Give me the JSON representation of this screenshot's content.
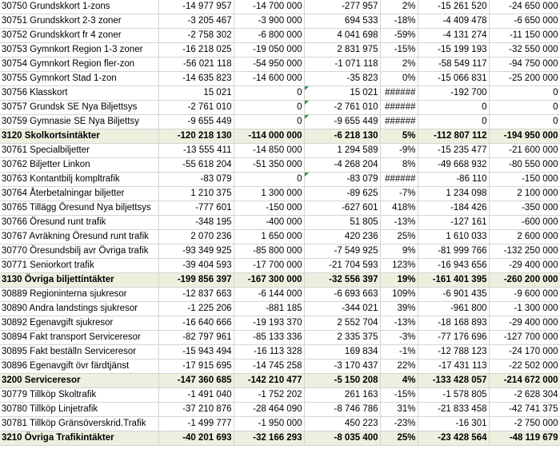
{
  "sheet": {
    "rows": [
      {
        "name": "30750 Grundskkort 1-zons",
        "c1": "-14 977 957",
        "c2": "-14 700 000",
        "c3": "-277 957",
        "c4": "2%",
        "c5": "-15 261 520",
        "c6": "-24 650 000",
        "sum": false,
        "flag": false
      },
      {
        "name": "30751 Grundskkort 2-3 zoner",
        "c1": "-3 205 467",
        "c2": "-3 900 000",
        "c3": "694 533",
        "c4": "-18%",
        "c5": "-4 409 478",
        "c6": "-6 650 000",
        "sum": false,
        "flag": false
      },
      {
        "name": "30752 Grundskkort fr 4 zoner",
        "c1": "-2 758 302",
        "c2": "-6 800 000",
        "c3": "4 041 698",
        "c4": "-59%",
        "c5": "-4 131 274",
        "c6": "-11 150 000",
        "sum": false,
        "flag": false
      },
      {
        "name": "30753 Gymnkort Region 1-3 zoner",
        "c1": "-16 218 025",
        "c2": "-19 050 000",
        "c3": "2 831 975",
        "c4": "-15%",
        "c5": "-15 199 193",
        "c6": "-32 550 000",
        "sum": false,
        "flag": false
      },
      {
        "name": "30754 Gymnkort Region fler-zon",
        "c1": "-56 021 118",
        "c2": "-54 950 000",
        "c3": "-1 071 118",
        "c4": "2%",
        "c5": "-58 549 117",
        "c6": "-94 750 000",
        "sum": false,
        "flag": false
      },
      {
        "name": "30755 Gymnkort Stad 1-zon",
        "c1": "-14 635 823",
        "c2": "-14 600 000",
        "c3": "-35 823",
        "c4": "0%",
        "c5": "-15 066 831",
        "c6": "-25 200 000",
        "sum": false,
        "flag": false
      },
      {
        "name": "30756 Klasskort",
        "c1": "15 021",
        "c2": "0",
        "c3": "15 021",
        "c4": "######",
        "c5": "-192 700",
        "c6": "0",
        "sum": false,
        "flag": true
      },
      {
        "name": "30757 Grundsk SE Nya Biljettsys",
        "c1": "-2 761 010",
        "c2": "0",
        "c3": "-2 761 010",
        "c4": "######",
        "c5": "0",
        "c6": "0",
        "sum": false,
        "flag": true
      },
      {
        "name": "30759 Gymnasie SE Nya Biljettsy",
        "c1": "-9 655 449",
        "c2": "0",
        "c3": "-9 655 449",
        "c4": "######",
        "c5": "0",
        "c6": "0",
        "sum": false,
        "flag": true
      },
      {
        "name": "3120 Skolkortsintäkter",
        "c1": "-120 218 130",
        "c2": "-114 000 000",
        "c3": "-6 218 130",
        "c4": "5%",
        "c5": "-112 807 112",
        "c6": "-194 950 000",
        "sum": true,
        "flag": false
      },
      {
        "name": "30761 Specialbiljetter",
        "c1": "-13 555 411",
        "c2": "-14 850 000",
        "c3": "1 294 589",
        "c4": "-9%",
        "c5": "-15 235 477",
        "c6": "-21 600 000",
        "sum": false,
        "flag": false
      },
      {
        "name": "30762 Biljetter Linkon",
        "c1": "-55 618 204",
        "c2": "-51 350 000",
        "c3": "-4 268 204",
        "c4": "8%",
        "c5": "-49 668 932",
        "c6": "-80 550 000",
        "sum": false,
        "flag": false
      },
      {
        "name": "30763 Kontantbilj kompltrafik",
        "c1": "-83 079",
        "c2": "0",
        "c3": "-83 079",
        "c4": "######",
        "c5": "-86 110",
        "c6": "-150 000",
        "sum": false,
        "flag": true
      },
      {
        "name": "30764 Återbetalningar biljetter",
        "c1": "1 210 375",
        "c2": "1 300 000",
        "c3": "-89 625",
        "c4": "-7%",
        "c5": "1 234 098",
        "c6": "2 100 000",
        "sum": false,
        "flag": false
      },
      {
        "name": "30765 Tillägg Öresund Nya biljettsys",
        "c1": "-777 601",
        "c2": "-150 000",
        "c3": "-627 601",
        "c4": "418%",
        "c5": "-184 426",
        "c6": "-350 000",
        "sum": false,
        "flag": false
      },
      {
        "name": "30766 Öresund runt trafik",
        "c1": "-348 195",
        "c2": "-400 000",
        "c3": "51 805",
        "c4": "-13%",
        "c5": "-127 161",
        "c6": "-600 000",
        "sum": false,
        "flag": false
      },
      {
        "name": "30767 Avräkning Öresund runt trafik",
        "c1": "2 070 236",
        "c2": "1 650 000",
        "c3": "420 236",
        "c4": "25%",
        "c5": "1 610 033",
        "c6": "2 600 000",
        "sum": false,
        "flag": false
      },
      {
        "name": "30770 Öresundsbilj avr Övriga trafik",
        "c1": "-93 349 925",
        "c2": "-85 800 000",
        "c3": "-7 549 925",
        "c4": "9%",
        "c5": "-81 999 766",
        "c6": "-132 250 000",
        "sum": false,
        "flag": false
      },
      {
        "name": "30771 Seniorkort trafik",
        "c1": "-39 404 593",
        "c2": "-17 700 000",
        "c3": "-21 704 593",
        "c4": "123%",
        "c5": "-16 943 656",
        "c6": "-29 400 000",
        "sum": false,
        "flag": false
      },
      {
        "name": "3130 Övriga biljettintäkter",
        "c1": "-199 856 397",
        "c2": "-167 300 000",
        "c3": "-32 556 397",
        "c4": "19%",
        "c5": "-161 401 395",
        "c6": "-260 200 000",
        "sum": true,
        "flag": false
      },
      {
        "name": "30889 Regioninterna sjukresor",
        "c1": "-12 837 663",
        "c2": "-6 144 000",
        "c3": "-6 693 663",
        "c4": "109%",
        "c5": "-6 901 435",
        "c6": "-9 600 000",
        "sum": false,
        "flag": false
      },
      {
        "name": "30890 Andra landstings sjukresor",
        "c1": "-1 225 206",
        "c2": "-881 185",
        "c3": "-344 021",
        "c4": "39%",
        "c5": "-961 800",
        "c6": "-1 300 000",
        "sum": false,
        "flag": false
      },
      {
        "name": "30892 Egenavgift sjukresor",
        "c1": "-16 640 666",
        "c2": "-19 193 370",
        "c3": "2 552 704",
        "c4": "-13%",
        "c5": "-18 168 893",
        "c6": "-29 400 000",
        "sum": false,
        "flag": false
      },
      {
        "name": "30894 Fakt transport Serviceresor",
        "c1": "-82 797 961",
        "c2": "-85 133 336",
        "c3": "2 335 375",
        "c4": "-3%",
        "c5": "-77 176 696",
        "c6": "-127 700 000",
        "sum": false,
        "flag": false
      },
      {
        "name": "30895 Fakt beställn Serviceresor",
        "c1": "-15 943 494",
        "c2": "-16 113 328",
        "c3": "169 834",
        "c4": "-1%",
        "c5": "-12 788 123",
        "c6": "-24 170 000",
        "sum": false,
        "flag": false
      },
      {
        "name": "30896 Egenavgift övr färdtjänst",
        "c1": "-17 915 695",
        "c2": "-14 745 258",
        "c3": "-3 170 437",
        "c4": "22%",
        "c5": "-17 431 113",
        "c6": "-22 502 000",
        "sum": false,
        "flag": false
      },
      {
        "name": "3200 Serviceresor",
        "c1": "-147 360 685",
        "c2": "-142 210 477",
        "c3": "-5 150 208",
        "c4": "4%",
        "c5": "-133 428 057",
        "c6": "-214 672 000",
        "sum": true,
        "flag": false
      },
      {
        "name": "30779 Tillköp Skoltrafik",
        "c1": "-1 491 040",
        "c2": "-1 752 202",
        "c3": "261 163",
        "c4": "-15%",
        "c5": "-1 578 805",
        "c6": "-2 628 304",
        "sum": false,
        "flag": false
      },
      {
        "name": "30780 Tillköp Linjetrafik",
        "c1": "-37 210 876",
        "c2": "-28 464 090",
        "c3": "-8 746 786",
        "c4": "31%",
        "c5": "-21 833 458",
        "c6": "-42 741 375",
        "sum": false,
        "flag": false
      },
      {
        "name": "30781 Tillköp Gränsöverskrid.Trafik",
        "c1": "-1 499 777",
        "c2": "-1 950 000",
        "c3": "450 223",
        "c4": "-23%",
        "c5": "-16 301",
        "c6": "-2 750 000",
        "sum": false,
        "flag": false
      },
      {
        "name": "3210 Övriga Trafikintäkter",
        "c1": "-40 201 693",
        "c2": "-32 166 293",
        "c3": "-8 035 400",
        "c4": "25%",
        "c5": "-23 428 564",
        "c6": "-48 119 679",
        "sum": true,
        "flag": false
      }
    ]
  }
}
